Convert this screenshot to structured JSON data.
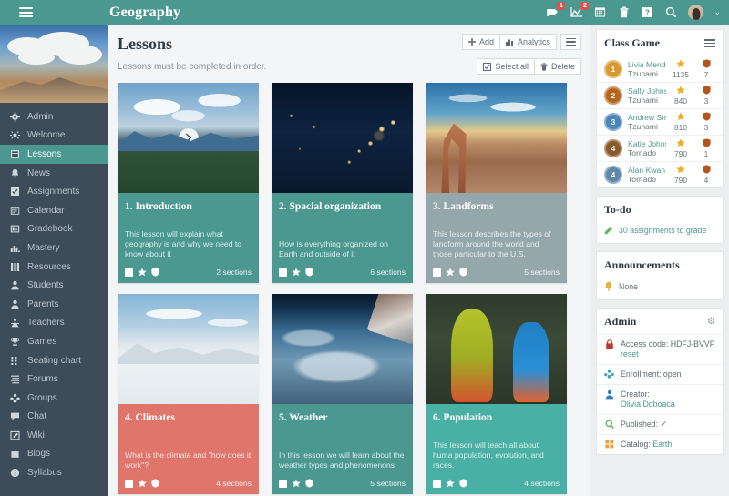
{
  "topbar": {
    "menu_icon": "hamburger-icon",
    "title": "Geography",
    "icons": [
      {
        "name": "notifications-icon",
        "badge": "1"
      },
      {
        "name": "analytics-icon",
        "badge": "2"
      },
      {
        "name": "calendar-icon",
        "badge": ""
      },
      {
        "name": "trash-icon",
        "badge": ""
      },
      {
        "name": "help-icon",
        "badge": "",
        "glyph": "?"
      },
      {
        "name": "search-icon",
        "badge": ""
      }
    ],
    "caret": "⌄"
  },
  "sidebar": {
    "items": [
      {
        "label": "Admin",
        "icon": "gear-icon",
        "active": false
      },
      {
        "label": "Welcome",
        "icon": "sun-icon",
        "active": false
      },
      {
        "label": "Lessons",
        "icon": "book-icon",
        "active": true
      },
      {
        "label": "News",
        "icon": "bell-icon",
        "active": false
      },
      {
        "label": "Assignments",
        "icon": "checklist-icon",
        "active": false
      },
      {
        "label": "Calendar",
        "icon": "calendar-icon",
        "active": false
      },
      {
        "label": "Gradebook",
        "icon": "gradebook-icon",
        "active": false
      },
      {
        "label": "Mastery",
        "icon": "bar-chart-icon",
        "active": false
      },
      {
        "label": "Resources",
        "icon": "columns-icon",
        "active": false
      },
      {
        "label": "Students",
        "icon": "user-icon",
        "active": false
      },
      {
        "label": "Parents",
        "icon": "user-icon",
        "active": false
      },
      {
        "label": "Teachers",
        "icon": "teacher-icon",
        "active": false
      },
      {
        "label": "Games",
        "icon": "trophy-icon",
        "active": false
      },
      {
        "label": "Seating chart",
        "icon": "grid-dots-icon",
        "active": false
      },
      {
        "label": "Forums",
        "icon": "list-icon",
        "active": false
      },
      {
        "label": "Groups",
        "icon": "groups-icon",
        "active": false
      },
      {
        "label": "Chat",
        "icon": "chat-icon",
        "active": false
      },
      {
        "label": "Wiki",
        "icon": "edit-icon",
        "active": false
      },
      {
        "label": "Blogs",
        "icon": "blog-icon",
        "active": false
      },
      {
        "label": "Syllabus",
        "icon": "info-icon",
        "active": false
      }
    ]
  },
  "main": {
    "title": "Lessons",
    "subtitle": "Lessons must be completed in order.",
    "add_label": "Add",
    "analytics_label": "Analytics",
    "menu_icon": "hamburger-icon",
    "select_all_label": "Select all",
    "delete_label": "Delete",
    "cards": [
      {
        "title": "1. Introduction",
        "desc": "This lesson will explain what geography is and why we need to know about it",
        "sections": "2 sections",
        "color": "#4b9890",
        "thumb": "t-mountain",
        "play": true
      },
      {
        "title": "2. Spacial organization",
        "desc": "How is everything organized on Earth and outside of it",
        "sections": "6 sections",
        "color": "#4b9890",
        "thumb": "t-nightlights",
        "play": false
      },
      {
        "title": "3. Landforms",
        "desc": "This lesson describes the types of landform around the world and those particular to the U.S.",
        "sections": "5 sections",
        "color": "#94a8ab",
        "thumb": "t-arch",
        "play": false
      },
      {
        "title": "4. Climates",
        "desc": "What is the climate and \"how does it work\"?",
        "sections": "4 sections",
        "color": "#e0756c",
        "thumb": "t-snow",
        "play": false
      },
      {
        "title": "5. Weather",
        "desc": "In this lesson we will learn about the weather types and phenomenons",
        "sections": "5 sections",
        "color": "#4b9890",
        "thumb": "t-earth",
        "play": false
      },
      {
        "title": "6. Population",
        "desc": "This lesson will teach all about huma population, evolution, and races.",
        "sections": "4 sections",
        "color": "#4ab0a6",
        "thumb": "t-dance",
        "play": false
      }
    ]
  },
  "right": {
    "class_game": {
      "title": "Class Game",
      "players": [
        {
          "rank": "1",
          "name": "Livia Mendes",
          "team": "Tzunami",
          "points": "1135",
          "shields": "7",
          "avatar": "#d89a2e"
        },
        {
          "rank": "2",
          "name": "Sally Johnson",
          "team": "Tzunami",
          "points": "840",
          "shields": "3",
          "avatar": "#b5651d"
        },
        {
          "rank": "3",
          "name": "Andrew Smith",
          "team": "Tzunami",
          "points": "810",
          "shields": "3",
          "avatar": "#4a86b8"
        },
        {
          "rank": "4",
          "name": "Katie Johnson",
          "team": "Tornado",
          "points": "790",
          "shields": "1",
          "avatar": "#8a5a2b"
        },
        {
          "rank": "4",
          "name": "Alan Kwan",
          "team": "Tornado",
          "points": "790",
          "shields": "4",
          "avatar": "#5e87a8"
        }
      ],
      "star_icon": "star-icon",
      "shield_icon": "shield-icon"
    },
    "todo": {
      "title": "To-do",
      "icon": "pencil-icon",
      "text": "30 assignments to grade"
    },
    "announcements": {
      "title": "Announcements",
      "icon": "bell-icon",
      "text": "None"
    },
    "admin": {
      "title": "Admin",
      "gear_icon": "gear-icon",
      "rows": [
        {
          "icon": "lock-icon",
          "label": "Access code: HDFJ-BVVP",
          "link": "reset"
        },
        {
          "icon": "groups-icon",
          "label": "Enrollment: open",
          "link": ""
        },
        {
          "icon": "user-icon",
          "label": "Creator:",
          "link": "Olivia Doboaca"
        },
        {
          "icon": "search-icon",
          "label": "Published:",
          "link": "",
          "check": "✓"
        },
        {
          "icon": "catalog-icon",
          "label": "Catalog:",
          "link": "Earth"
        }
      ]
    }
  },
  "colors": {
    "brand": "#4b9890",
    "sidebar": "#3e4c59",
    "badge": "#d9534f",
    "link": "#4b9890"
  }
}
